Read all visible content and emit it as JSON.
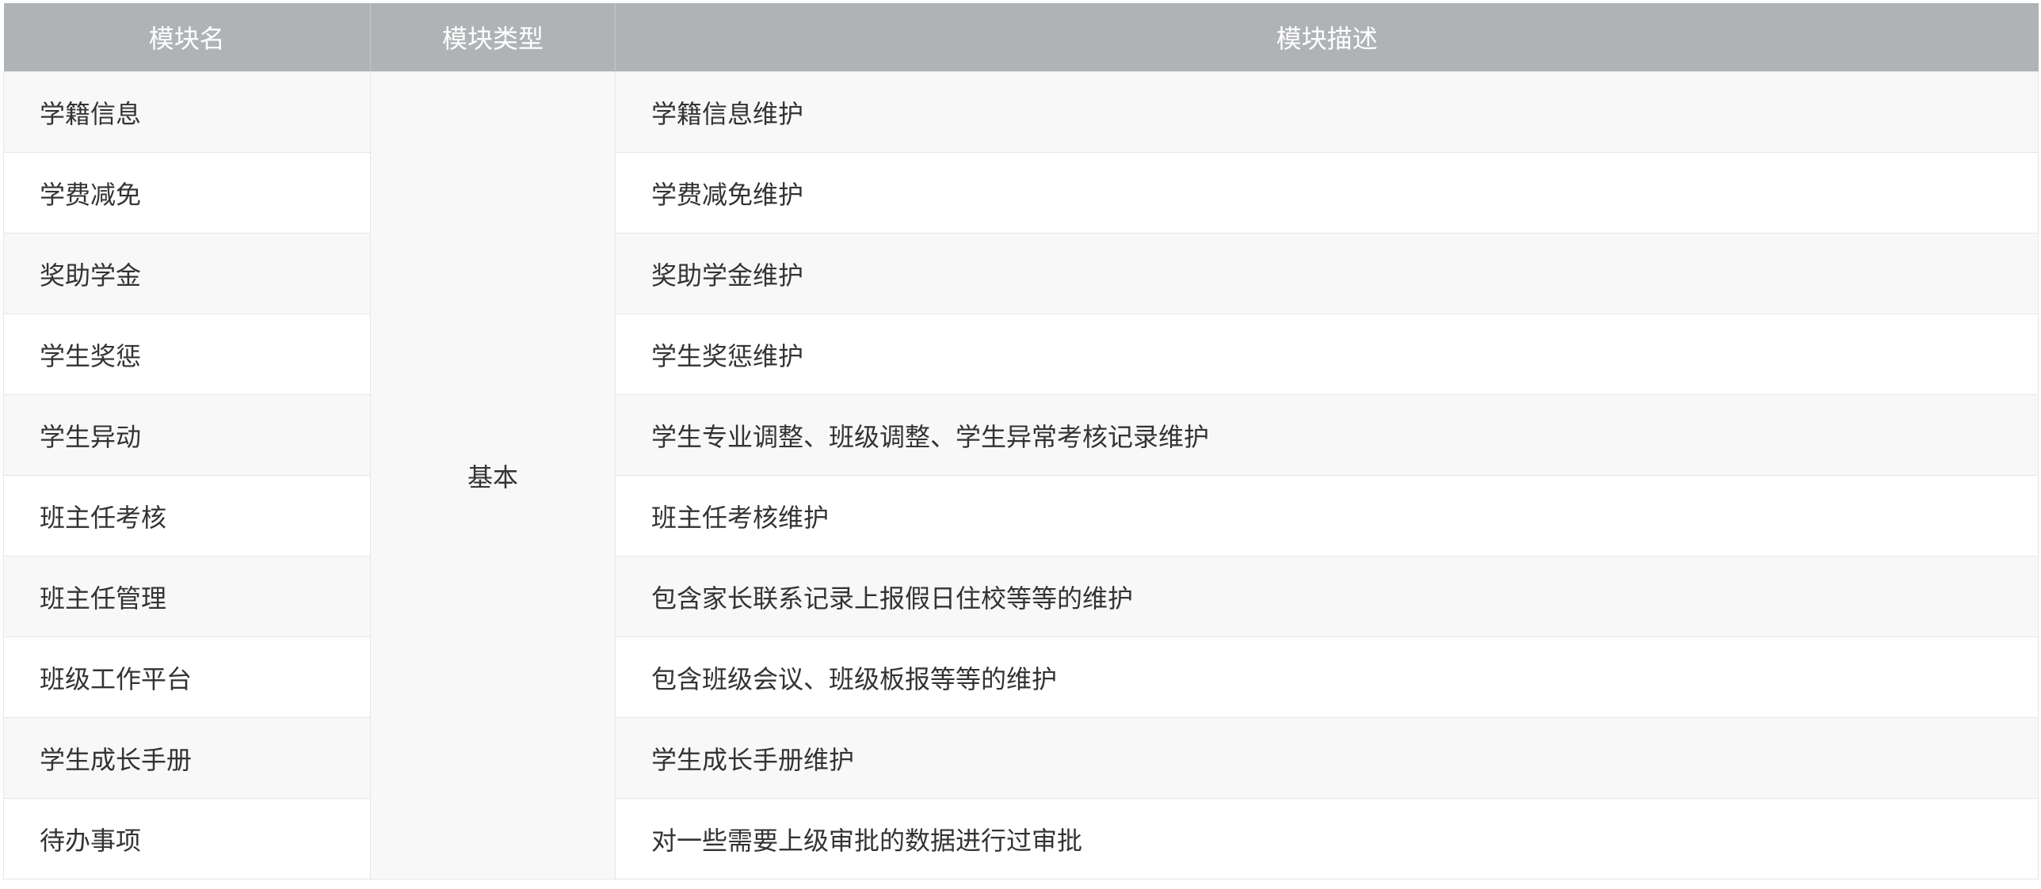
{
  "table": {
    "headers": [
      "模块名",
      "模块类型",
      "模块描述"
    ],
    "type_value": "基本",
    "rows": [
      {
        "name": "学籍信息",
        "desc": "学籍信息维护"
      },
      {
        "name": "学费减免",
        "desc": "学费减免维护"
      },
      {
        "name": "奖助学金",
        "desc": "奖助学金维护"
      },
      {
        "name": "学生奖惩",
        "desc": "学生奖惩维护"
      },
      {
        "name": "学生异动",
        "desc": "学生专业调整、班级调整、学生异常考核记录维护"
      },
      {
        "name": "班主任考核",
        "desc": "班主任考核维护"
      },
      {
        "name": "班主任管理",
        "desc": "包含家长联系记录上报假日住校等等的维护"
      },
      {
        "name": "班级工作平台",
        "desc": "包含班级会议、班级板报等等的维护"
      },
      {
        "name": "学生成长手册",
        "desc": "学生成长手册维护"
      },
      {
        "name": "待办事项",
        "desc": "对一些需要上级审批的数据进行过审批"
      }
    ]
  }
}
